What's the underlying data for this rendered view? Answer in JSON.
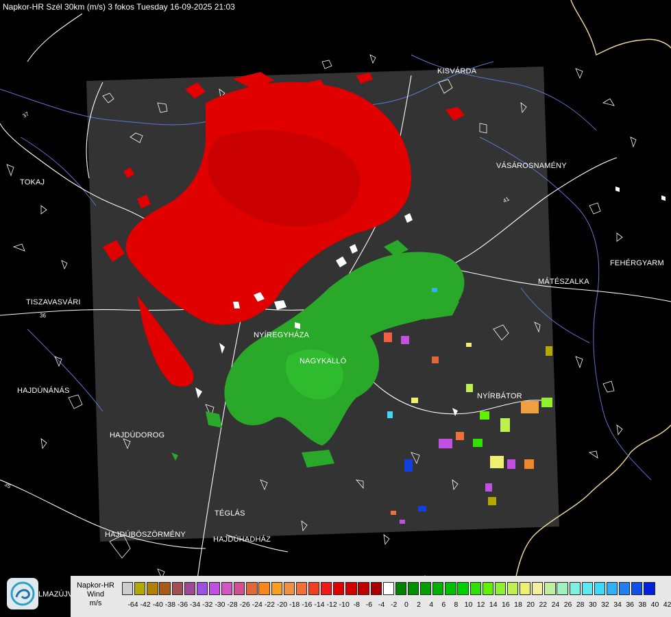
{
  "header": {
    "title": "Napkor-HR Szél 30km (m/s) 3 fokos Tuesday 16-09-2025 21:03"
  },
  "map": {
    "cities": [
      {
        "name": "KISVÁRDA"
      },
      {
        "name": "TOKAJ"
      },
      {
        "name": "VÁSÁROSNAMÉNY"
      },
      {
        "name": "FEHÉRGYARM"
      },
      {
        "name": "MÁTÉSZALKA"
      },
      {
        "name": "TISZAVASVÁRI"
      },
      {
        "name": "NYÍREGYHÁZA"
      },
      {
        "name": "NAGYKALLÓ"
      },
      {
        "name": "HAJDÚNÁNÁS"
      },
      {
        "name": "NYÍRBÁTOR"
      },
      {
        "name": "HAJDÚDOROG"
      },
      {
        "name": "TÉGLÁS"
      },
      {
        "name": "HAJDÚBÖSZÖRMÉNY"
      },
      {
        "name": "HAJDÚHADHÁZ"
      }
    ],
    "road_numbers": [
      "37",
      "41",
      "36",
      "35"
    ],
    "colors": {
      "radar_background": "#333333",
      "approaching": "#e00000",
      "receding": "#2aa82a",
      "roads": "#ffffff",
      "rivers": "#5a78c8",
      "border": "#e8d49a"
    }
  },
  "legend": {
    "title_line1": "Napkor-HR",
    "title_line2": "Wind",
    "title_line3": "m/s",
    "colors": [
      "#cccccc",
      "#b5a800",
      "#b08000",
      "#a85a18",
      "#a05050",
      "#a04898",
      "#a050e0",
      "#c050e0",
      "#d058c0",
      "#d05090",
      "#e06838",
      "#f88818",
      "#f8a020",
      "#f09040",
      "#f07038",
      "#f04020",
      "#f01818",
      "#e00000",
      "#d00000",
      "#c00000",
      "#a80000",
      "#ffffff",
      "#008000",
      "#009000",
      "#00a000",
      "#00b000",
      "#00c000",
      "#00d000",
      "#30e000",
      "#60f000",
      "#90f030",
      "#c0f050",
      "#f0f070",
      "#f0f0a0",
      "#c0f0a0",
      "#a0f0c0",
      "#80f0e0",
      "#60e8f0",
      "#40d8f8",
      "#30b0f8",
      "#2080f0",
      "#1050e8",
      "#0020e0"
    ],
    "labels": [
      "-64",
      "-42",
      "-40",
      "-38",
      "-36",
      "-34",
      "-32",
      "-30",
      "-28",
      "-26",
      "-24",
      "-22",
      "-20",
      "-18",
      "-16",
      "-14",
      "-12",
      "-10",
      "-8",
      "-6",
      "-4",
      "-2",
      "0",
      "2",
      "4",
      "6",
      "8",
      "10",
      "12",
      "14",
      "16",
      "18",
      "20",
      "22",
      "24",
      "26",
      "28",
      "30",
      "32",
      "34",
      "36",
      "38",
      "40",
      "42"
    ]
  },
  "logo": {
    "text": "LMAZÚJVÁR"
  }
}
